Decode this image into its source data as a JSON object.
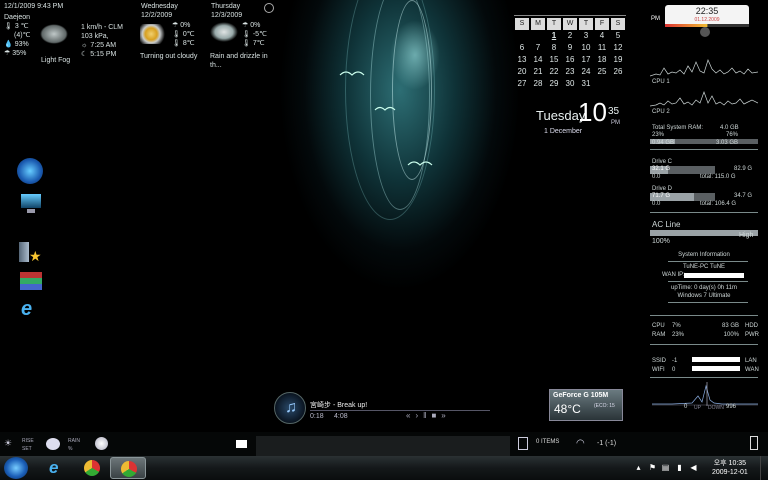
{
  "weather": {
    "current": {
      "datetime": "12/1/2009 9:43 PM",
      "location": "Daejeon",
      "temp": "3",
      "temp_paren": "(4)",
      "humidity": "93%",
      "precip": "35%",
      "condition": "Light Fog",
      "wind": "1 km/h - CLM",
      "pressure": "103 kPa,",
      "sunrise": "7:25 AM",
      "sunset": "5:15 PM"
    },
    "days": [
      {
        "day": "Wednesday",
        "date": "12/2/2009",
        "precip": "0%",
        "low": "0",
        "high": "8",
        "condition": "Turning out cloudy"
      },
      {
        "day": "Thursday",
        "date": "12/3/2009",
        "precip": "0%",
        "low": "-5",
        "high": "7",
        "condition": "Rain and drizzle in th..."
      }
    ]
  },
  "calendar": {
    "weekdays": [
      "S",
      "M",
      "T",
      "W",
      "T",
      "F",
      "S"
    ],
    "weeks": [
      [
        "",
        "",
        "1",
        "2",
        "3",
        "4",
        "5"
      ],
      [
        "6",
        "7",
        "8",
        "9",
        "10",
        "11",
        "12"
      ],
      [
        "13",
        "14",
        "15",
        "16",
        "17",
        "18",
        "19"
      ],
      [
        "20",
        "21",
        "22",
        "23",
        "24",
        "25",
        "26"
      ],
      [
        "27",
        "28",
        "29",
        "30",
        "31",
        "",
        ""
      ]
    ],
    "today": "1"
  },
  "clock": {
    "weekday": "Tuesday",
    "hour": "10",
    "minute": "35",
    "ampm": "PM",
    "date": "1 December"
  },
  "right_panel": {
    "ampm": "PM",
    "time": "22:35",
    "date": "01.12.2009",
    "cpu1": "CPU 1",
    "cpu2": "CPU 2",
    "ram_label": "Total System RAM:",
    "ram_total": "4.0 GB",
    "ram_pct_left": "23%",
    "ram_pct_right": "76%",
    "ram_used": "0.94 GB",
    "ram_free": "3.03 GB",
    "ram_fill": 0.23,
    "drive_c_label": "Drive C",
    "drive_c_used": "32.1 G",
    "drive_c_free": "82.9 G",
    "drive_c_zero": "0.0",
    "drive_c_total": "total: 115.0 G",
    "drive_c_fill": 0.28,
    "drive_d_label": "Drive D",
    "drive_d_used": "71.7 G",
    "drive_d_free": "34.7 G",
    "drive_d_zero": "0.0",
    "drive_d_total": "total: 106.4 G",
    "drive_d_fill": 0.67,
    "ac_label": "AC Line",
    "ac_pct": "100%",
    "ac_state": "High",
    "ac_fill": 1.0,
    "sysinfo_title": "System Information",
    "pc_name": "TuNE-PC  TuNE",
    "wan_label": "WAN IP:",
    "uptime": "upTime: 0 day(s) 0h 11m",
    "os": "Windows 7 Ultimate",
    "cpu_label": "CPU",
    "cpu_val": "7%",
    "ram_label2": "RAM",
    "ram_val": "23%",
    "hdd_size": "83 GB",
    "hdd_label": "HDD",
    "pwr_val": "100%",
    "pwr_label": "PWR",
    "ssid_label": "SSID",
    "ssid_val": "-1",
    "wifi_label": "WIFI",
    "wifi_val": "0",
    "lan_label": "LAN",
    "wan_label2": "WAN",
    "net_up_val": "0",
    "net_up_label": "UP",
    "net_down_label": "DOWN",
    "net_down_val": "996"
  },
  "media": {
    "track": "宮崎步 - Break up!",
    "elapsed": "0:18",
    "duration": "4:08"
  },
  "gpu": {
    "name": "GeForce G 105M",
    "temp": "48°C",
    "sub": "(ECO: 15"
  },
  "bottom": {
    "rise": "RISE",
    "set": "SET",
    "rain": "RAIN",
    "rain_val": "%",
    "recycle_items": "0 ITEMS",
    "wifi_text": "-1  (-1)"
  },
  "taskbar": {
    "time": "오후 10:35",
    "date": "2009-12-01"
  }
}
